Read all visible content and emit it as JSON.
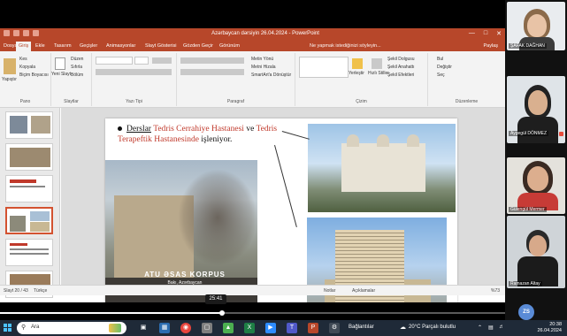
{
  "ppt": {
    "title": "Azərbaycan dərsiyin 26.04.2024 - PowerPoint",
    "tabs": [
      "Dosya",
      "Giriş",
      "Ekle",
      "Tasarım",
      "Geçişler",
      "Animasyonlar",
      "Slayt Gösterisi",
      "Gözden Geçir",
      "Görünüm"
    ],
    "active_tab": "Giriş",
    "search": "Ne yapmak istediğinizi söyleyin...",
    "share": "Paylaş",
    "ribbon": {
      "pano": "Pano",
      "kes": "Kes",
      "kopyala": "Kopyala",
      "bicim": "Biçim Boyacısı",
      "yapistir": "Yapıştır",
      "slaytlar": "Slaytlar",
      "yeni_slayt": "Yeni Slayt",
      "duzen": "Düzen",
      "sifirla": "Sıfırla",
      "bolum": "Bölüm",
      "yazi_tipi": "Yazı Tipi",
      "paragraf": "Paragraf",
      "metin_yonu": "Metin Yönü",
      "metni_hizala": "Metni Hizala",
      "smartart": "SmartArt'a Dönüştür",
      "cizim": "Çizim",
      "yerlestir": "Yerleştir",
      "hizli_stiller": "Hızlı Stiller",
      "sekil_dolgusu": "Şekil Dolgusu",
      "sekil_anahat": "Şekil Anahattı",
      "sekil_efekt": "Şekil Efektleri",
      "duzenleme": "Düzenleme",
      "bul": "Bul",
      "degistir": "Değiştir",
      "sec": "Seç"
    },
    "slide_numbers": [
      "",
      "",
      "",
      "",
      "",
      ""
    ],
    "slide": {
      "w_derslar": "Derslar",
      "w_hosp1": "Tedris Cerrahiye Hastanesi",
      "w_ve": "ve",
      "w_hosp2": "Tedris Terapeftik Hastanesinde",
      "w_end": "işleniyor.",
      "caption": "ATU ƏSAS KORPUS",
      "subcaption": "Bakı, Azərbaycan"
    },
    "status": {
      "slide": "Slayt 20 / 43",
      "language": "Türkçe",
      "notes": "Notlar",
      "comments": "Açıklamalar",
      "zoom": "%73"
    }
  },
  "video": {
    "time": "25:41",
    "progress": 0.44
  },
  "participants": [
    {
      "name": "ŞAFAK DAĞHAN"
    },
    {
      "name": "Aygegül DÖNMEZ"
    },
    {
      "name": "Gülengül Mermer"
    },
    {
      "name": "Ramazan Altay"
    }
  ],
  "zs_badge": "ZS",
  "taskbar": {
    "search_placeholder": "Ara",
    "news": "Bağlantılar",
    "weather": "20°C Parçalı bulutlu",
    "time": "20:38",
    "date": "26.04.2024"
  },
  "colors": {
    "ppt_accent": "#b7472a",
    "slide_red": "#c0392b",
    "taskbar": "#1f2a38"
  }
}
